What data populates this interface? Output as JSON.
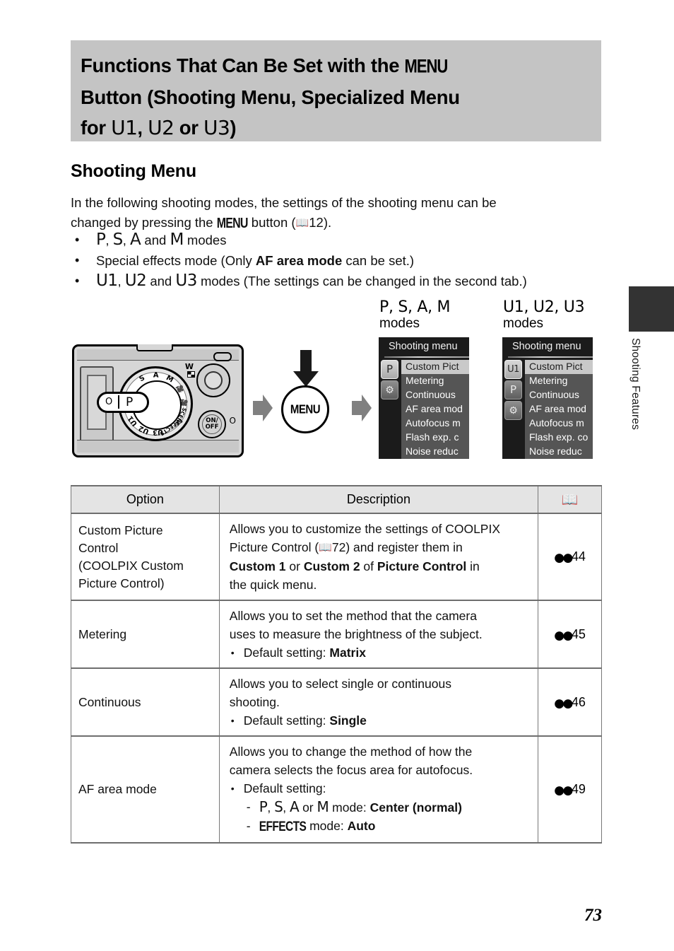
{
  "header": {
    "title_line1_pre": "Functions That Can Be Set with the ",
    "title_menu_glyph": "MENU",
    "title_line2": "Button (Shooting Menu, Specialized Menu",
    "title_line3_pre": "for ",
    "title_u1": "U1",
    "title_sep1": ", ",
    "title_u2": "U2",
    "title_or": " or ",
    "title_u3": "U3",
    "title_close": ")"
  },
  "section": {
    "heading": "Shooting Menu"
  },
  "intro": {
    "line1": "In the following shooting modes, the settings of the shooting menu can be",
    "line2_pre": "changed by pressing the ",
    "menu_glyph": "MENU",
    "line2_mid": " button (",
    "book_icon": "book-icon",
    "page_ref": "12",
    "line2_end": ")."
  },
  "bullets": [
    {
      "id": "psam-modes",
      "parts": [
        {
          "t": "P",
          "style": "mletter"
        },
        {
          "t": ", ",
          "style": "plain"
        },
        {
          "t": "S",
          "style": "mletter"
        },
        {
          "t": ", ",
          "style": "plain"
        },
        {
          "t": "A",
          "style": "mletter"
        },
        {
          "t": " and ",
          "style": "plain"
        },
        {
          "t": "M",
          "style": "mletter"
        },
        {
          "t": " modes",
          "style": "plain"
        }
      ]
    },
    {
      "id": "special-effects-mode",
      "parts": [
        {
          "t": "Special effects mode (Only ",
          "style": "plain"
        },
        {
          "t": "AF area mode",
          "style": "bold"
        },
        {
          "t": " can be set.)",
          "style": "plain"
        }
      ]
    },
    {
      "id": "u-modes",
      "parts": [
        {
          "t": "U1",
          "style": "mletter"
        },
        {
          "t": ", ",
          "style": "plain"
        },
        {
          "t": "U2",
          "style": "mletter"
        },
        {
          "t": " and ",
          "style": "plain"
        },
        {
          "t": "U3",
          "style": "mletter"
        },
        {
          "t": " modes (The settings can be changed in the second tab.)",
          "style": "plain"
        }
      ]
    }
  ],
  "figure": {
    "caption_1_modes": "P, S, A, M",
    "caption_1_sub": "modes",
    "caption_2_modes": "U1, U2, U3",
    "caption_2_sub": "modes",
    "menu_button_label": "MENU",
    "dial": {
      "selected_mode": "P",
      "callout_left_symbol": "O",
      "markings": [
        "S",
        "A",
        "M",
        "movie-icon",
        "csm-movie-icon",
        "SCENE",
        "EFFECTS",
        "U3",
        "U2",
        "U1",
        "P"
      ],
      "onoff_label_line1": "ON/",
      "onoff_label_line2": "OFF",
      "wide_label": "W",
      "side_symbol": "O"
    },
    "screen_1": {
      "title": "Shooting menu",
      "tabs": [
        {
          "label": "P",
          "selected": true,
          "name": "tab-shooting-p"
        },
        {
          "label": "⚙",
          "selected": false,
          "name": "tab-setup-wrench"
        }
      ],
      "items": [
        {
          "label": "Custom Pict",
          "highlighted": true
        },
        {
          "label": "Metering",
          "highlighted": false
        },
        {
          "label": "Continuous",
          "highlighted": false
        },
        {
          "label": "AF area mod",
          "highlighted": false
        },
        {
          "label": "Autofocus m",
          "highlighted": false
        },
        {
          "label": "Flash exp. c",
          "highlighted": false
        },
        {
          "label": "Noise reduc",
          "highlighted": false
        }
      ]
    },
    "screen_2": {
      "title": "Shooting menu",
      "tabs": [
        {
          "label": "U1",
          "selected": true,
          "name": "tab-user-u1"
        },
        {
          "label": "P",
          "selected": false,
          "name": "tab-shooting-p"
        },
        {
          "label": "⚙",
          "selected": false,
          "name": "tab-setup-wrench"
        }
      ],
      "items": [
        {
          "label": "Custom Pict",
          "highlighted": true
        },
        {
          "label": "Metering",
          "highlighted": false
        },
        {
          "label": "Continuous",
          "highlighted": false
        },
        {
          "label": "AF area mod",
          "highlighted": false
        },
        {
          "label": "Autofocus m",
          "highlighted": false
        },
        {
          "label": "Flash exp. co",
          "highlighted": false
        },
        {
          "label": "Noise reduc",
          "highlighted": false
        }
      ]
    }
  },
  "side_tab": {
    "label": "Shooting Features"
  },
  "table": {
    "headers": {
      "option": "Option",
      "description": "Description",
      "reference": "book-icon"
    },
    "rows": [
      {
        "option_lines": [
          "Custom Picture",
          "Control",
          "(COOLPIX Custom",
          "Picture Control)"
        ],
        "desc_lines": [
          [
            {
              "t": "Allows you to customize the settings of COOLPIX",
              "style": "plain"
            }
          ],
          [
            {
              "t": "Picture Control (",
              "style": "plain"
            },
            {
              "t": "book-icon",
              "style": "book"
            },
            {
              "t": "72) and register them in",
              "style": "plain"
            }
          ],
          [
            {
              "t": "Custom 1",
              "style": "bold"
            },
            {
              "t": " or ",
              "style": "plain"
            },
            {
              "t": "Custom 2",
              "style": "bold"
            },
            {
              "t": " of ",
              "style": "plain"
            },
            {
              "t": "Picture Control",
              "style": "bold"
            },
            {
              "t": " in",
              "style": "plain"
            }
          ],
          [
            {
              "t": "the quick menu.",
              "style": "plain"
            }
          ]
        ],
        "ref": "44"
      },
      {
        "option_lines": [
          "Metering"
        ],
        "desc_lines": [
          [
            {
              "t": "Allows you to set the method that the camera",
              "style": "plain"
            }
          ],
          [
            {
              "t": "uses to measure the brightness of the subject.",
              "style": "plain"
            }
          ],
          [
            {
              "t": "Default setting: ",
              "style": "bulleted"
            },
            {
              "t": "Matrix",
              "style": "bold"
            }
          ]
        ],
        "ref": "45"
      },
      {
        "option_lines": [
          "Continuous"
        ],
        "desc_lines": [
          [
            {
              "t": "Allows you to select single or continuous",
              "style": "plain"
            }
          ],
          [
            {
              "t": "shooting.",
              "style": "plain"
            }
          ],
          [
            {
              "t": "Default setting: ",
              "style": "bulleted"
            },
            {
              "t": "Single",
              "style": "bold"
            }
          ]
        ],
        "ref": "46"
      },
      {
        "option_lines": [
          "AF area mode"
        ],
        "desc_lines": [
          [
            {
              "t": "Allows you to change the method of how the",
              "style": "plain"
            }
          ],
          [
            {
              "t": "camera selects the focus area for autofocus.",
              "style": "plain"
            }
          ],
          [
            {
              "t": "Default setting:",
              "style": "bulleted"
            }
          ],
          [
            {
              "t": "P",
              "style": "sub-mletter"
            },
            {
              "t": ", ",
              "style": "sub"
            },
            {
              "t": "S",
              "style": "sub-mletter"
            },
            {
              "t": ", ",
              "style": "sub"
            },
            {
              "t": "A",
              "style": "sub-mletter"
            },
            {
              "t": " or ",
              "style": "sub"
            },
            {
              "t": "M",
              "style": "sub-mletter"
            },
            {
              "t": " mode: ",
              "style": "sub"
            },
            {
              "t": "Center (normal)",
              "style": "sub-bold"
            }
          ],
          [
            {
              "t": "EFFECTS",
              "style": "sub-effects"
            },
            {
              "t": " mode: ",
              "style": "sub"
            },
            {
              "t": "Auto",
              "style": "sub-bold"
            }
          ]
        ],
        "ref": "49"
      }
    ]
  },
  "page_number": "73"
}
